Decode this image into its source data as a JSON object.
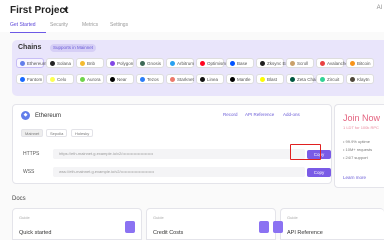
{
  "header": {
    "project_title": "First Project",
    "avatar_text": "Al",
    "tabs": [
      "Get Started",
      "Security",
      "Metrics",
      "Settings"
    ]
  },
  "chains": {
    "title": "Chains",
    "tag": "Supports in Mainnet",
    "items": [
      {
        "label": "Ethereum",
        "color": "#627eea",
        "selected": true
      },
      {
        "label": "Solana",
        "color": "#222222"
      },
      {
        "label": "Bnb",
        "color": "#f3ba2f"
      },
      {
        "label": "Polygon",
        "color": "#8247e5"
      },
      {
        "label": "Gnosis",
        "color": "#3e6957"
      },
      {
        "label": "Arbitrum",
        "color": "#28a0f0"
      },
      {
        "label": "Optimism",
        "color": "#ff0420"
      },
      {
        "label": "Base",
        "color": "#0052ff"
      },
      {
        "label": "Zksync Era",
        "color": "#1e1e1e"
      },
      {
        "label": "Scroll",
        "color": "#c9a06a"
      },
      {
        "label": "Avalanche",
        "color": "#e84142"
      },
      {
        "label": "Bitcoin",
        "color": "#f7931a"
      },
      {
        "label": "Fantom",
        "color": "#1969ff"
      },
      {
        "label": "Celo",
        "color": "#fcff52"
      },
      {
        "label": "Aurora",
        "color": "#70d44b"
      },
      {
        "label": "Near",
        "color": "#000000"
      },
      {
        "label": "Tezos",
        "color": "#2c7df7"
      },
      {
        "label": "Starknet",
        "color": "#ec796b"
      },
      {
        "label": "Linea",
        "color": "#121212"
      },
      {
        "label": "Mantle",
        "color": "#000000"
      },
      {
        "label": "Blast",
        "color": "#fcfc03"
      },
      {
        "label": "Zeta Chain",
        "color": "#005741"
      },
      {
        "label": "Zircuit",
        "color": "#32d296"
      },
      {
        "label": "Klaytn",
        "color": "#4f473b"
      }
    ]
  },
  "endpoint": {
    "chain_label": "Ethereum",
    "links": [
      "Record",
      "API Reference",
      "Add-ons"
    ],
    "network_tabs": [
      "Mainnet",
      "Sepolia",
      "Holesky"
    ],
    "rows": [
      {
        "label": "HTTPS",
        "url": "https://eth-mainnet.g.example.io/v2/••••••••••••••••••••••",
        "button": "Copy"
      },
      {
        "label": "WSS",
        "url": "wss://eth-mainnet.g.example.io/v2/••••••••••••••••••••••••",
        "button": "Copy"
      }
    ]
  },
  "promo": {
    "title": "Join Now",
    "subtitle": "1 LDT for 100k RPC",
    "items": [
      "• 99.9% uptime",
      "• 10M+ requests",
      "• 24/7 support"
    ],
    "cta": "Learn more"
  },
  "docs": {
    "title": "Docs",
    "cards": [
      {
        "kicker": "Guide",
        "title": "Quick started",
        "icon_color": "#8b72f2"
      },
      {
        "kicker": "Guide",
        "title": "Credit Costs",
        "icon_color": "#8b72f2"
      },
      {
        "kicker": "Guide",
        "title": "API Reference",
        "icon_color": "#8b72f2"
      }
    ]
  }
}
